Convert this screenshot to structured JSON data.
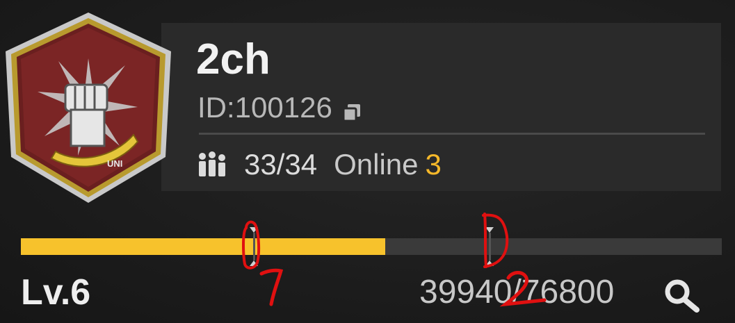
{
  "guild": {
    "name": "2ch",
    "id_label": "ID:",
    "id_value": "100126",
    "emblem_text": "UNI",
    "members": "33/34",
    "online_label": "Online",
    "online_count": "3"
  },
  "level": {
    "label": "Lv.6",
    "exp": "39940/76800",
    "progress_fraction": 0.52
  },
  "annotations": [
    "1",
    "2"
  ],
  "colors": {
    "accent": "#f5b82a",
    "progress_fill": "#f7c22c",
    "annotation": "#e01010"
  },
  "icons": [
    "guild-emblem-icon",
    "copy-icon",
    "members-icon",
    "search-icon"
  ]
}
